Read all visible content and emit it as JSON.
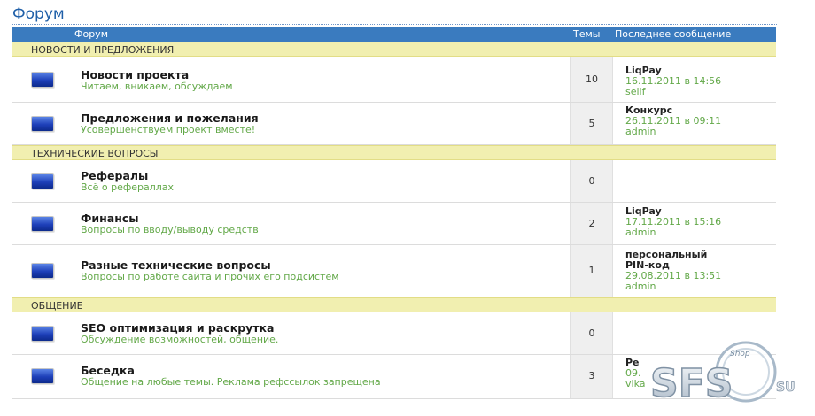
{
  "page": {
    "title": "Форум"
  },
  "table_header": {
    "forum": "Форум",
    "topics": "Темы",
    "last_post": "Последнее сообщение"
  },
  "categories": [
    {
      "name": "НОВОСТИ И ПРЕДЛОЖЕНИЯ",
      "forums": [
        {
          "name": "Новости проекта",
          "desc": "Читаем, вникаем, обсуждаем",
          "topics": "10",
          "last": {
            "title": "LiqPay",
            "date": "16.11.2011 в 14:56",
            "author": "sellf"
          }
        },
        {
          "name": "Предложения и пожелания",
          "desc": "Усовершенствуем проект вместе!",
          "topics": "5",
          "last": {
            "title": "Конкурс",
            "date": "26.11.2011 в 09:11",
            "author": "admin"
          }
        }
      ]
    },
    {
      "name": "ТЕХНИЧЕСКИЕ ВОПРОСЫ",
      "forums": [
        {
          "name": "Рефералы",
          "desc": "Всё о рефераллах",
          "topics": "0"
        },
        {
          "name": "Финансы",
          "desc": "Вопросы по вводу/выводу средств",
          "topics": "2",
          "last": {
            "title": "LiqPay",
            "date": "17.11.2011 в 15:16",
            "author": "admin"
          }
        },
        {
          "name": "Разные технические вопросы",
          "desc": "Вопросы по работе сайта и прочих его подсистем",
          "topics": "1",
          "last": {
            "title_line1": "персональный",
            "title_line2": "PIN-код",
            "date": "29.08.2011 в 13:51",
            "author": "admin"
          }
        }
      ]
    },
    {
      "name": "ОБЩЕНИЕ",
      "forums": [
        {
          "name": "SEO оптимизация и раскрутка",
          "desc": "Обсуждение возможностей, общение.",
          "topics": "0"
        },
        {
          "name": "Беседка",
          "desc": "Общение на любые темы. Реклама рефссылок запрещена",
          "topics": "3",
          "last": {
            "title": "Ре",
            "date": "09.",
            "author": "vika"
          }
        }
      ]
    }
  ],
  "watermark": {
    "brand": "SFS",
    "tld": "SU",
    "badge": "Shop"
  },
  "colors": {
    "header_bg": "#3a7bbf",
    "category_bg": "#f1efb0",
    "accent_green": "#62a848",
    "title_blue": "#1f5fa8"
  }
}
